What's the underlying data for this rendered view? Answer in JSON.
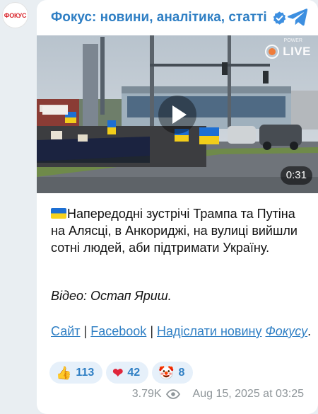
{
  "channel": {
    "avatar_text": "ФОКУС",
    "title": "Фокус: новини, аналітика, статті"
  },
  "video": {
    "live_label": "LIVE",
    "live_sublabel": "POWER",
    "duration": "0:31"
  },
  "post": {
    "text": "Напередодні зустрічі Трампа та Путіна на Алясці, в Анкориджі, на вулиці вийшли сотні людей, аби підтримати Україну.",
    "credit": "Відео: Остап Яриш.",
    "links": {
      "site": "Сайт",
      "facebook": "Facebook",
      "send_news": "Надіслати новину",
      "fokusu": "Фокусу",
      "separator": "|"
    }
  },
  "reactions": [
    {
      "icon": "thumbs-up-icon",
      "emoji": "👍",
      "count": "113"
    },
    {
      "icon": "heart-icon",
      "emoji": "❤",
      "count": "42"
    },
    {
      "icon": "clown-face-icon",
      "emoji": "🤡",
      "count": "8"
    }
  ],
  "meta": {
    "views": "3.79K",
    "timestamp": "Aug 15, 2025 at 03:25"
  },
  "colors": {
    "accent": "#2f7fc4",
    "background": "#e9eef2",
    "reaction_bg": "#e6f0fa",
    "meta_text": "#8e9599",
    "avatar_text": "#d8232a"
  }
}
